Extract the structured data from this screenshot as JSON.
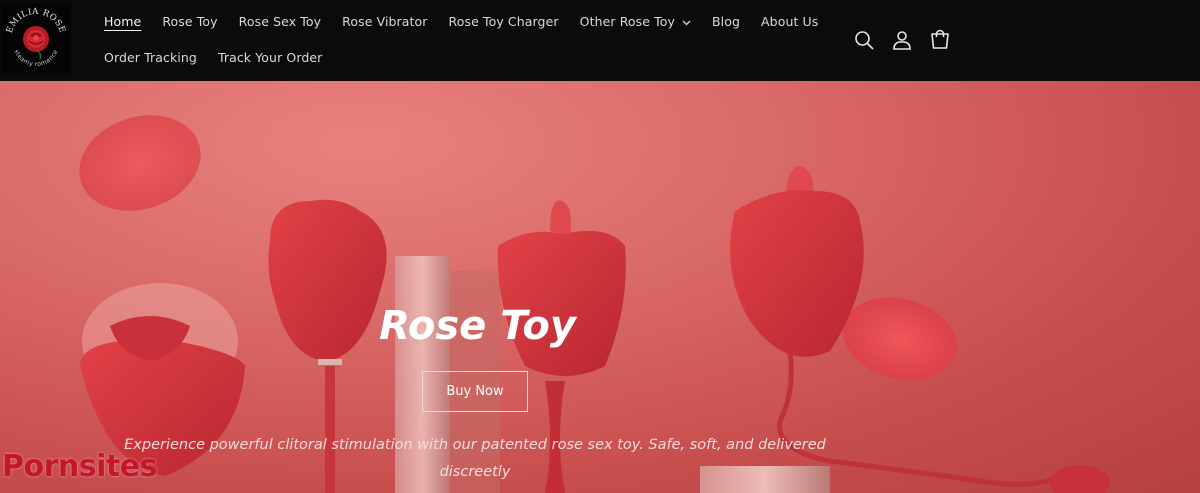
{
  "brand": {
    "logo_top_text": "EMILIA ROSE",
    "logo_bottom_text": "steamy romance"
  },
  "nav": {
    "row1": [
      {
        "label": "Home",
        "active": true
      },
      {
        "label": "Rose Toy"
      },
      {
        "label": "Rose Sex Toy"
      },
      {
        "label": "Rose Vibrator"
      },
      {
        "label": "Rose Toy Charger"
      },
      {
        "label": "Other Rose Toy",
        "has_dropdown": true
      },
      {
        "label": "Blog"
      },
      {
        "label": "About Us"
      }
    ],
    "row2": [
      {
        "label": "Order Tracking"
      },
      {
        "label": "Track Your Order"
      }
    ]
  },
  "header_icons": [
    "search-icon",
    "account-icon",
    "cart-icon"
  ],
  "hero": {
    "title": "Rose Toy",
    "button_label": "Buy Now",
    "description": "Experience powerful clitoral stimulation with our patented rose sex toy. Safe, soft, and delivered discreetly"
  },
  "watermark": "Pornsites",
  "colors": {
    "header_bg": "#0b0b0b",
    "hero_bg": "#d96a67",
    "rose_red": "#d8353a",
    "watermark": "#c6162b"
  }
}
